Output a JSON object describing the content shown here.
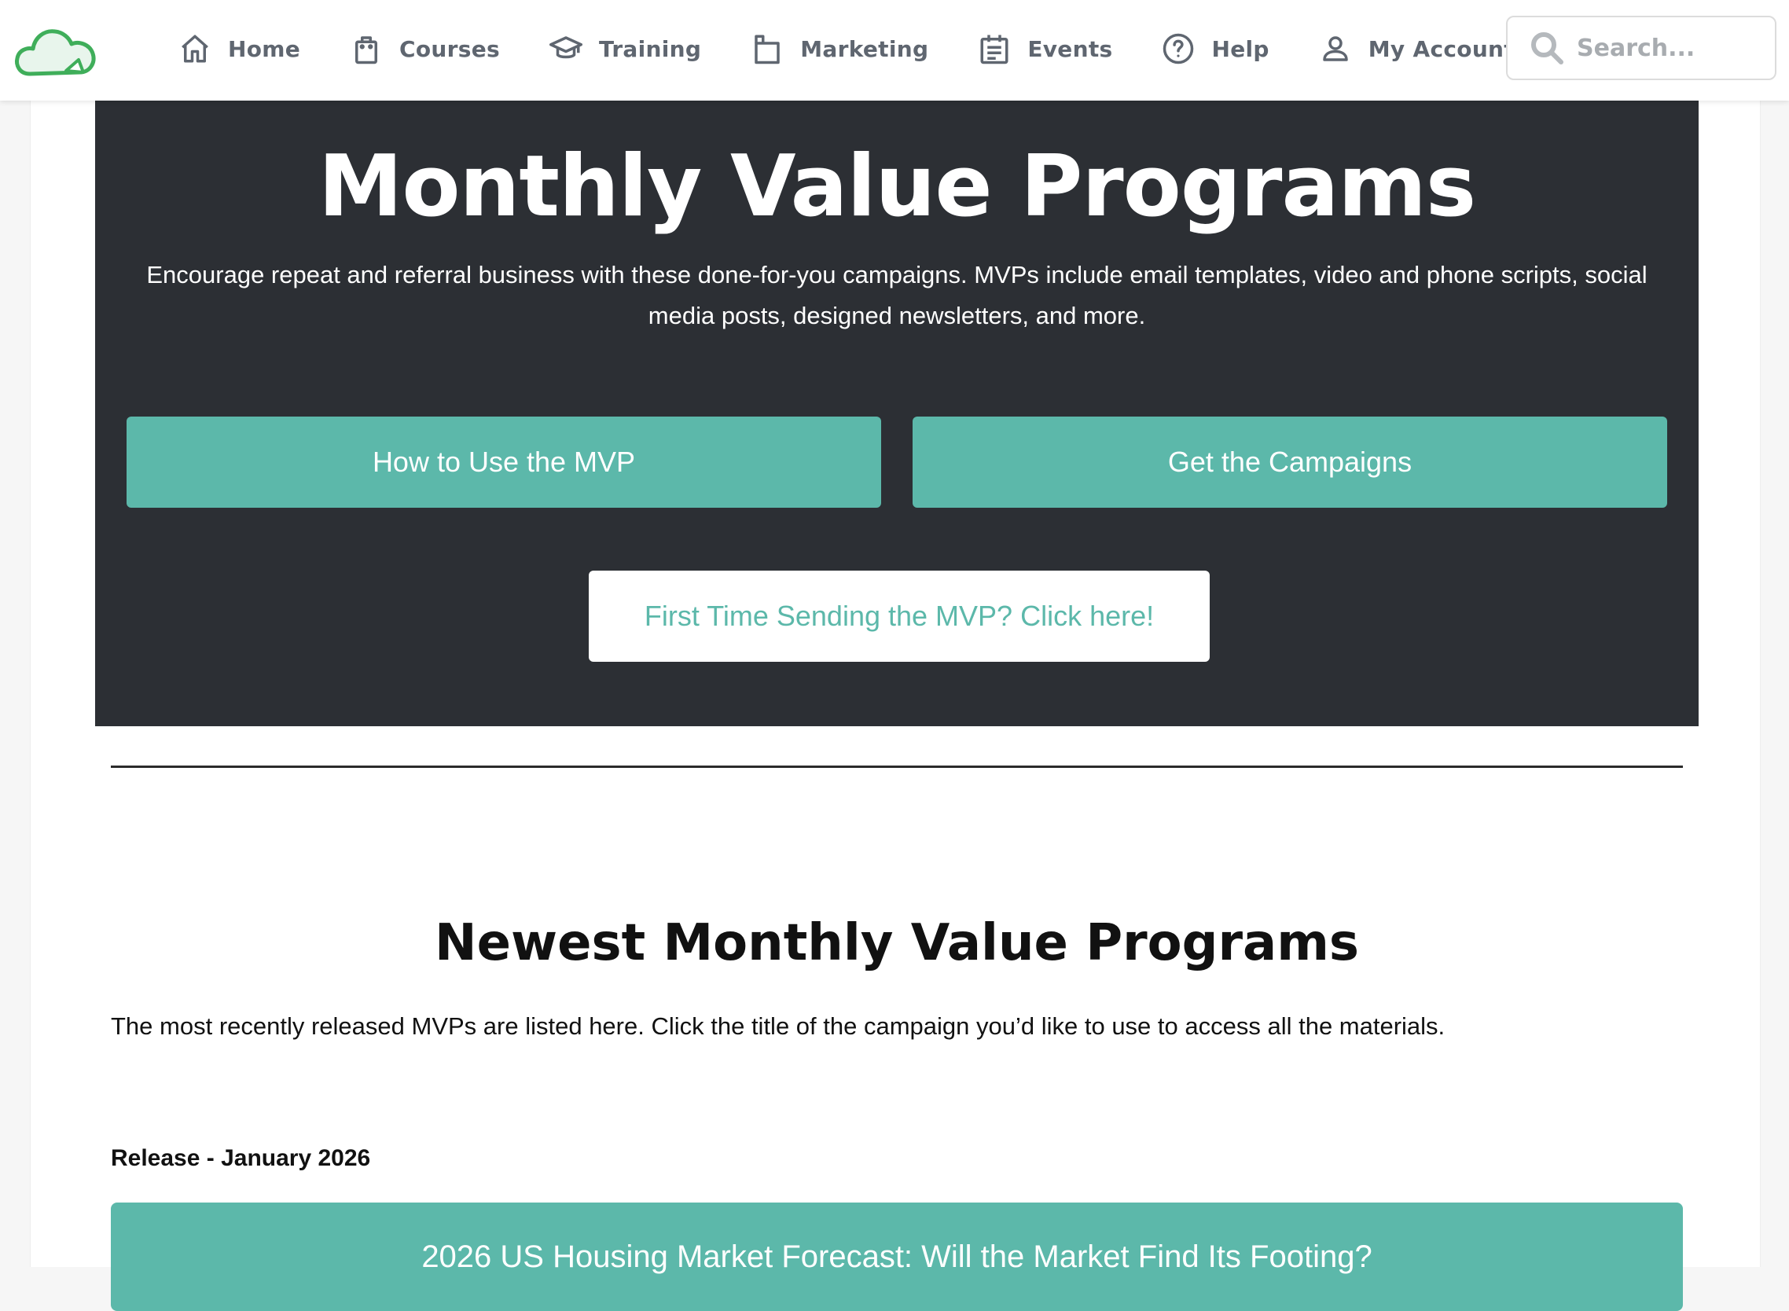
{
  "colors": {
    "hero_bg": "#2c2f34",
    "accent_teal": "#5cb8aa",
    "logo_green": "#3fae5a",
    "nav_text": "#5f6670"
  },
  "nav": {
    "logo_icon": "cloud-logo-icon",
    "items": [
      {
        "label": "Home",
        "icon": "home-icon"
      },
      {
        "label": "Courses",
        "icon": "shopping-bag-icon"
      },
      {
        "label": "Training",
        "icon": "graduation-cap-icon"
      },
      {
        "label": "Marketing",
        "icon": "marketing-icon"
      },
      {
        "label": "Events",
        "icon": "calendar-icon"
      },
      {
        "label": "Help",
        "icon": "help-circle-icon"
      },
      {
        "label": "My Account",
        "icon": "user-icon"
      }
    ],
    "search": {
      "placeholder": "Search...",
      "value": "",
      "icon": "search-icon"
    }
  },
  "hero": {
    "title": "Monthly Value Programs",
    "description": "Encourage repeat and referral business with these done-for-you campaigns. MVPs include email templates, video and phone scripts, social media posts, designed newsletters, and more.",
    "buttons": {
      "how_to": "How to Use the MVP",
      "get_campaigns": "Get the Campaigns",
      "first_time": "First Time Sending the MVP? Click here!"
    }
  },
  "newest": {
    "title": "Newest Monthly Value Programs",
    "description": "The most recently released MVPs are listed here. Click the title of the campaign you’d like to use to access all the materials.",
    "release_label": "Release - January 2026",
    "campaign_title": "2026 US Housing Market Forecast: Will the Market Find Its Footing?"
  }
}
